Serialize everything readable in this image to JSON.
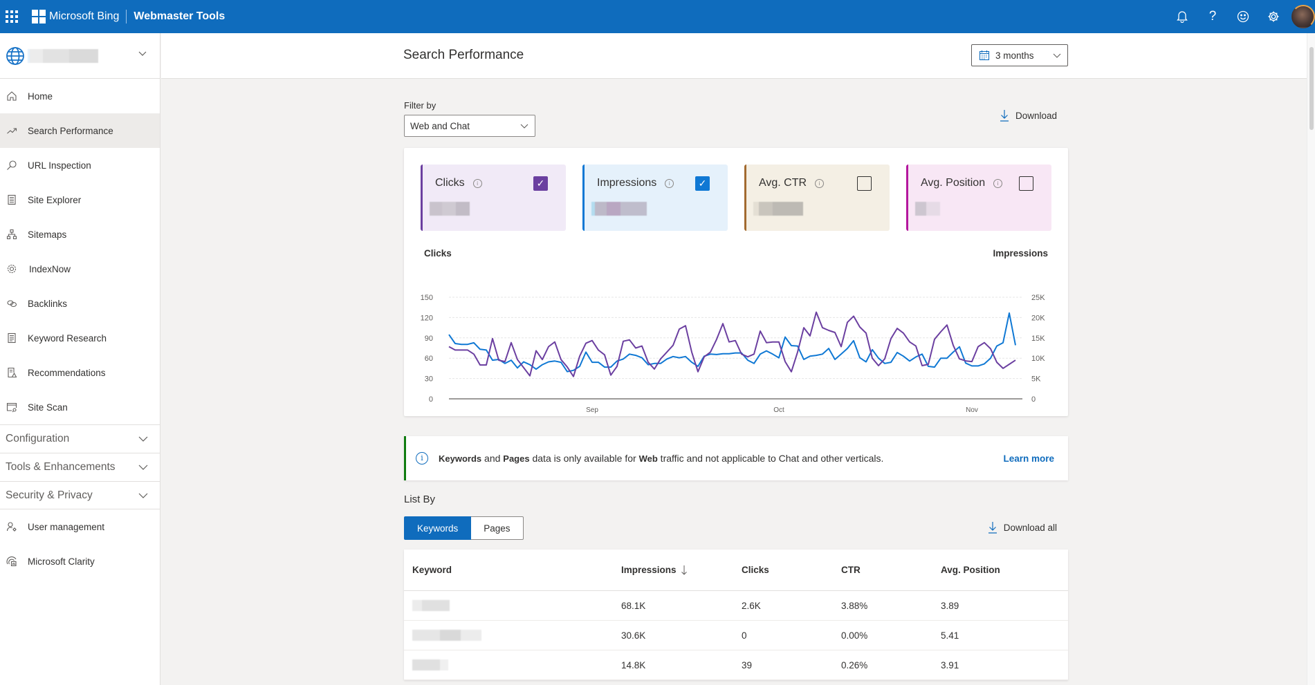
{
  "topbar": {
    "brand": "Microsoft Bing",
    "product": "Webmaster Tools",
    "icons": [
      "app-launcher-icon",
      "bell-icon",
      "help-icon",
      "feedback-smiley-icon",
      "settings-gear-icon",
      "user-avatar"
    ],
    "help_glyph": "?"
  },
  "sidebar": {
    "site_selector": {
      "icon": "globe-icon",
      "value": ""
    },
    "items": [
      {
        "label": "Home",
        "icon": "home-icon",
        "active": false
      },
      {
        "label": "Search Performance",
        "icon": "trending-up-icon",
        "active": true
      },
      {
        "label": "URL Inspection",
        "icon": "search-icon",
        "active": false
      },
      {
        "label": "Site Explorer",
        "icon": "document-list-icon",
        "active": false
      },
      {
        "label": "Sitemaps",
        "icon": "sitemap-icon",
        "active": false
      },
      {
        "label": "IndexNow",
        "icon": "gear-refresh-icon",
        "active": false
      },
      {
        "label": "Backlinks",
        "icon": "link-icon",
        "active": false
      },
      {
        "label": "Keyword Research",
        "icon": "document-icon",
        "active": false
      },
      {
        "label": "Recommendations",
        "icon": "document-warning-icon",
        "active": false
      },
      {
        "label": "Site Scan",
        "icon": "window-search-icon",
        "active": false
      }
    ],
    "groups": [
      {
        "label": "Configuration"
      },
      {
        "label": "Tools & Enhancements"
      },
      {
        "label": "Security & Privacy"
      }
    ],
    "bottom_items": [
      {
        "label": "User management",
        "icon": "user-settings-icon"
      },
      {
        "label": "Microsoft Clarity",
        "icon": "clarity-icon"
      }
    ]
  },
  "page": {
    "title": "Search Performance",
    "date_range": "3 months",
    "filter_label": "Filter by",
    "filter_value": "Web and Chat",
    "download_label": "Download"
  },
  "metrics": [
    {
      "label": "Clicks",
      "checked": true,
      "color": "#6b3fa0",
      "bg": "#f1eaf7",
      "value": ""
    },
    {
      "label": "Impressions",
      "checked": true,
      "color": "#0f78d4",
      "bg": "#e5f1fb",
      "value": ""
    },
    {
      "label": "Avg. CTR",
      "checked": false,
      "color": "#a26a2f",
      "bg": "#f4efe4",
      "value": ""
    },
    {
      "label": "Avg. Position",
      "checked": false,
      "color": "#b4169d",
      "bg": "#f8e7f5",
      "value": ""
    }
  ],
  "chart_data": {
    "type": "line",
    "title": "",
    "left_axis_label": "Clicks",
    "right_axis_label": "Impressions",
    "left_ylim": [
      0,
      150
    ],
    "right_ylim": [
      0,
      25000
    ],
    "left_ticks": [
      "0",
      "30",
      "60",
      "90",
      "120",
      "150"
    ],
    "right_ticks": [
      "0",
      "5K",
      "10K",
      "15K",
      "20K",
      "25K"
    ],
    "x_tick_labels": [
      {
        "label": "Sep",
        "index": 23
      },
      {
        "label": "Oct",
        "index": 53
      },
      {
        "label": "Nov",
        "index": 84
      }
    ],
    "grid": true,
    "series": [
      {
        "name": "Clicks",
        "axis": "left",
        "color": "#6b3fa0",
        "values": [
          77,
          72,
          72,
          72,
          66,
          50,
          50,
          89,
          57,
          55,
          83,
          58,
          46,
          34,
          71,
          58,
          77,
          84,
          58,
          47,
          33,
          63,
          82,
          86,
          72,
          65,
          35,
          48,
          85,
          87,
          75,
          78,
          54,
          44,
          59,
          69,
          79,
          103,
          108,
          69,
          40,
          62,
          69,
          88,
          111,
          84,
          86,
          66,
          62,
          66,
          100,
          83,
          84,
          84,
          55,
          40,
          69,
          105,
          93,
          128,
          105,
          101,
          98,
          77,
          113,
          122,
          106,
          97,
          60,
          49,
          59,
          89,
          104,
          97,
          84,
          78,
          49,
          51,
          88,
          99,
          109,
          79,
          59,
          56,
          55,
          77,
          83,
          74,
          54,
          45,
          51,
          57
        ]
      },
      {
        "name": "Impressions",
        "axis": "right",
        "color": "#0f78d4",
        "values": [
          15800,
          13600,
          13400,
          13400,
          13800,
          12200,
          12000,
          9500,
          9700,
          8700,
          9500,
          7600,
          9100,
          8400,
          7300,
          8400,
          9100,
          9300,
          9000,
          6700,
          7000,
          8000,
          11500,
          9000,
          9000,
          7800,
          7800,
          9300,
          9800,
          11000,
          10700,
          10100,
          8400,
          8700,
          8700,
          9800,
          10400,
          10100,
          10400,
          9000,
          8000,
          10500,
          11000,
          10900,
          11100,
          11100,
          11300,
          11300,
          9500,
          8700,
          11000,
          11800,
          11000,
          10100,
          15200,
          13100,
          13000,
          9700,
          10500,
          10700,
          11000,
          12400,
          9700,
          11000,
          12400,
          14300,
          10100,
          9100,
          12100,
          10000,
          8700,
          9000,
          11400,
          10500,
          9300,
          10300,
          11000,
          8000,
          7800,
          10000,
          10000,
          11500,
          12800,
          8800,
          8100,
          8100,
          8600,
          10000,
          13000,
          13800,
          21100,
          13200
        ]
      }
    ]
  },
  "banner": {
    "bold1": "Keywords",
    "t1": " and ",
    "bold2": "Pages",
    "t2": " data is only available for ",
    "bold3": "Web",
    "t3": " traffic and not applicable to Chat and other verticals.",
    "link": "Learn more"
  },
  "list": {
    "label": "List By",
    "tabs": [
      {
        "label": "Keywords",
        "active": true
      },
      {
        "label": "Pages",
        "active": false
      }
    ],
    "download_all": "Download all",
    "columns": [
      "Keyword",
      "Impressions",
      "Clicks",
      "CTR",
      "Avg. Position"
    ],
    "sorted_column": "Impressions",
    "sort_direction": "descending",
    "rows": [
      {
        "keyword": "",
        "impressions": "68.1K",
        "clicks": "2.6K",
        "ctr": "3.88%",
        "position": "3.89"
      },
      {
        "keyword": "",
        "impressions": "30.6K",
        "clicks": "0",
        "ctr": "0.00%",
        "position": "5.41"
      },
      {
        "keyword": "",
        "impressions": "14.8K",
        "clicks": "39",
        "ctr": "0.26%",
        "position": "3.91"
      }
    ]
  }
}
